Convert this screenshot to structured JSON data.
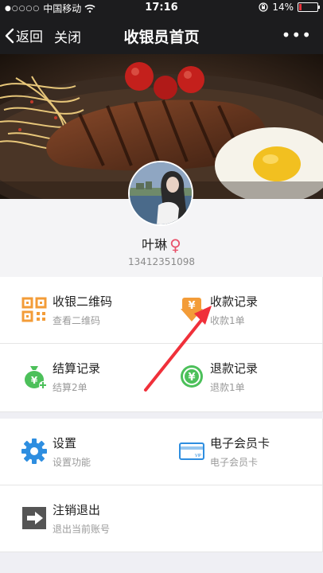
{
  "status_bar": {
    "carrier": "中国移动",
    "time": "17:16",
    "battery": "14%",
    "battery_level": 0.14
  },
  "nav": {
    "back_label": "返回",
    "close_label": "关闭",
    "title": "收银员首页",
    "more_label": "•••"
  },
  "profile": {
    "name": "叶琳",
    "gender_symbol": "♀",
    "phone": "13412351098"
  },
  "menu": [
    {
      "title": "收银二维码",
      "subtitle": "查看二维码",
      "icon": "qr-code-icon",
      "color": "#f39c38"
    },
    {
      "title": "收款记录",
      "subtitle": "收款1单",
      "icon": "yen-down-icon",
      "color": "#f39c38"
    },
    {
      "title": "结算记录",
      "subtitle": "结算2单",
      "icon": "money-bag-icon",
      "color": "#4cc05a"
    },
    {
      "title": "退款记录",
      "subtitle": "退款1单",
      "icon": "refund-icon",
      "color": "#4cc05a"
    },
    {
      "title": "设置",
      "subtitle": "设置功能",
      "icon": "gear-icon",
      "color": "#2e8ee0"
    },
    {
      "title": "电子会员卡",
      "subtitle": "电子会员卡",
      "icon": "vip-card-icon",
      "color": "#2e8ee0"
    },
    {
      "title": "注销退出",
      "subtitle": "退出当前账号",
      "icon": "logout-icon",
      "color": "#555555"
    }
  ],
  "annotation_color": "#f0303a"
}
